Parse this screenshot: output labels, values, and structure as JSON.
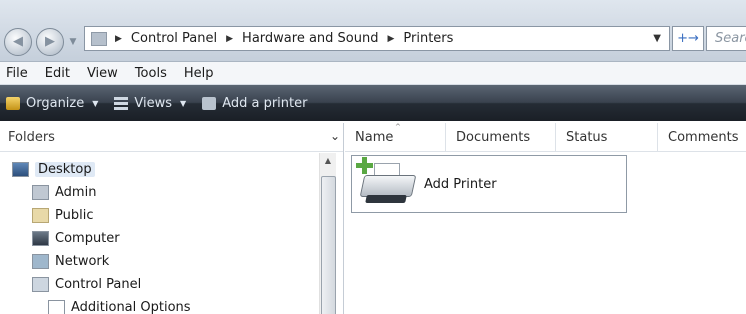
{
  "address_bar": {
    "breadcrumbs": [
      "Control Panel",
      "Hardware and Sound",
      "Printers"
    ],
    "search_placeholder": "Search",
    "refresh_glyph": "+→"
  },
  "menu": [
    "File",
    "Edit",
    "View",
    "Tools",
    "Help"
  ],
  "command_bar": {
    "organize": "Organize",
    "views": "Views",
    "add_printer": "Add a printer"
  },
  "folders": {
    "title": "Folders",
    "items": [
      {
        "label": "Desktop",
        "icon": "desktop-icon"
      },
      {
        "label": "Admin",
        "icon": "user-folder-icon"
      },
      {
        "label": "Public",
        "icon": "public-folder-icon"
      },
      {
        "label": "Computer",
        "icon": "computer-icon"
      },
      {
        "label": "Network",
        "icon": "network-icon"
      },
      {
        "label": "Control Panel",
        "icon": "control-panel-icon"
      },
      {
        "label": "Additional Options",
        "icon": "additional-options-icon"
      }
    ]
  },
  "columns": [
    "Name",
    "Documents",
    "Status",
    "Comments"
  ],
  "items": [
    {
      "label": "Add Printer",
      "icon": "add-printer-icon"
    }
  ],
  "colors": {
    "command_bar": "#2b323b",
    "address_bar": "#d3dbe5",
    "selection": "#dfe9f5"
  }
}
